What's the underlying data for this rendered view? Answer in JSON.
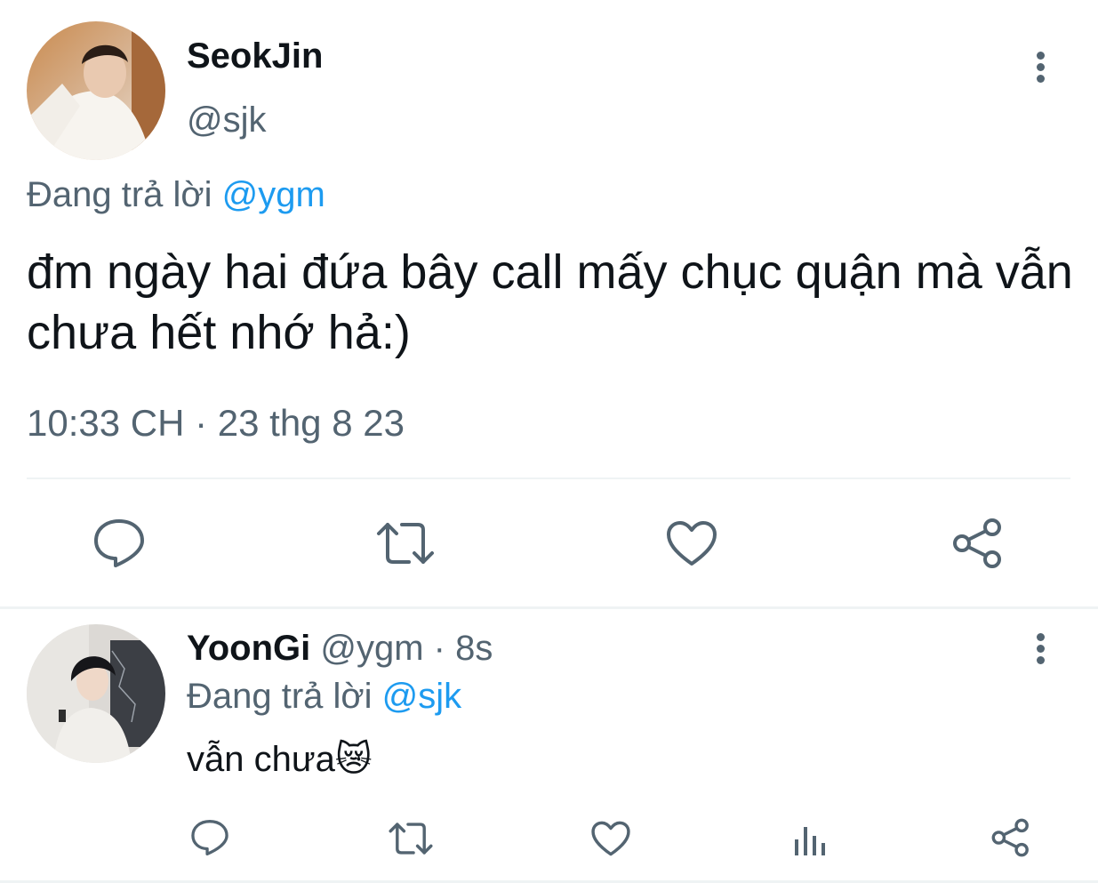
{
  "main_tweet": {
    "display_name": "SeokJin",
    "handle": "@sjk",
    "replying_prefix": "Đang trả lời",
    "replying_to": "@ygm",
    "text": "đm ngày hai đứa bây call mấy chục quận mà vẫn chưa hết nhớ hả:)",
    "timestamp": "10:33 CH · 23 thg 8 23",
    "actions": [
      "reply-icon",
      "retweet-icon",
      "like-icon",
      "share-icon"
    ]
  },
  "reply_tweet": {
    "display_name": "YoonGi",
    "handle": "@ygm",
    "time": "· 8s",
    "replying_prefix": "Đang trả lời",
    "replying_to": "@sjk",
    "text": "vẫn chưa",
    "emoji": "😿",
    "actions": [
      "reply-icon",
      "retweet-icon",
      "like-icon",
      "views-icon",
      "share-icon"
    ]
  },
  "colors": {
    "text": "#0f1419",
    "muted": "#536471",
    "link": "#1d9bf0",
    "divider": "#eff3f4"
  }
}
